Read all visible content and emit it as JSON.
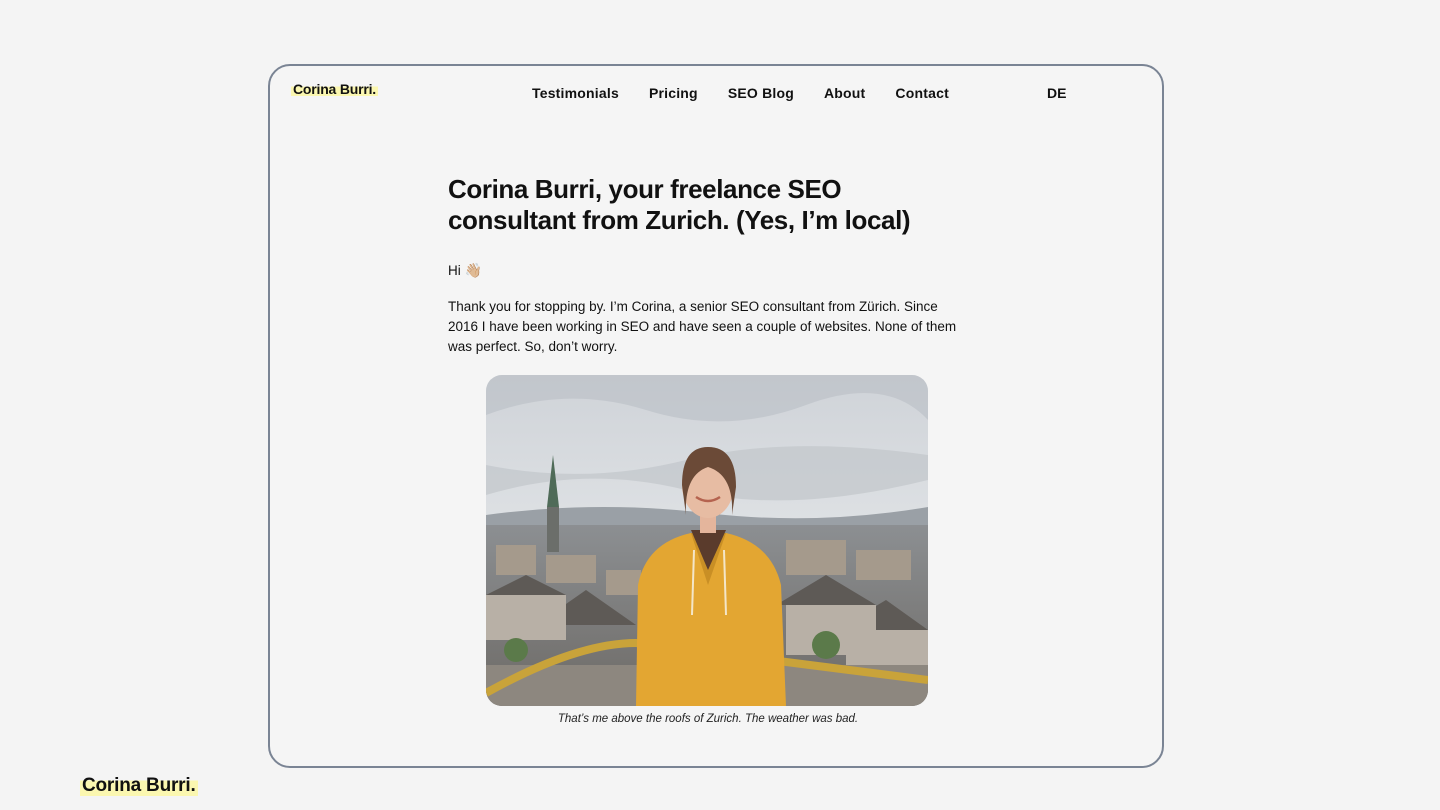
{
  "header": {
    "logo": "Corina Burri.",
    "nav": [
      {
        "label": "Testimonials"
      },
      {
        "label": "Pricing"
      },
      {
        "label": "SEO Blog"
      },
      {
        "label": "About"
      },
      {
        "label": "Contact"
      }
    ],
    "language": "DE"
  },
  "main": {
    "heading": "Corina Burri, your freelance SEO consultant from Zurich. (Yes, I’m local)",
    "greeting": "Hi",
    "greeting_emoji": "👋🏼",
    "intro": "Thank you for stopping by. I’m Corina, a senior SEO consultant from Zürich. Since 2016 I have been working in SEO and have seen a couple of websites. None of them was perfect. So, don’t worry.",
    "photo_caption": "That’s me above the roofs of Zurich. The weather was bad."
  },
  "footer": {
    "logo": "Corina Burri."
  },
  "colors": {
    "highlight": "#fbf7b0",
    "frame_border": "#7a8494",
    "jacket": "#e3a632"
  }
}
